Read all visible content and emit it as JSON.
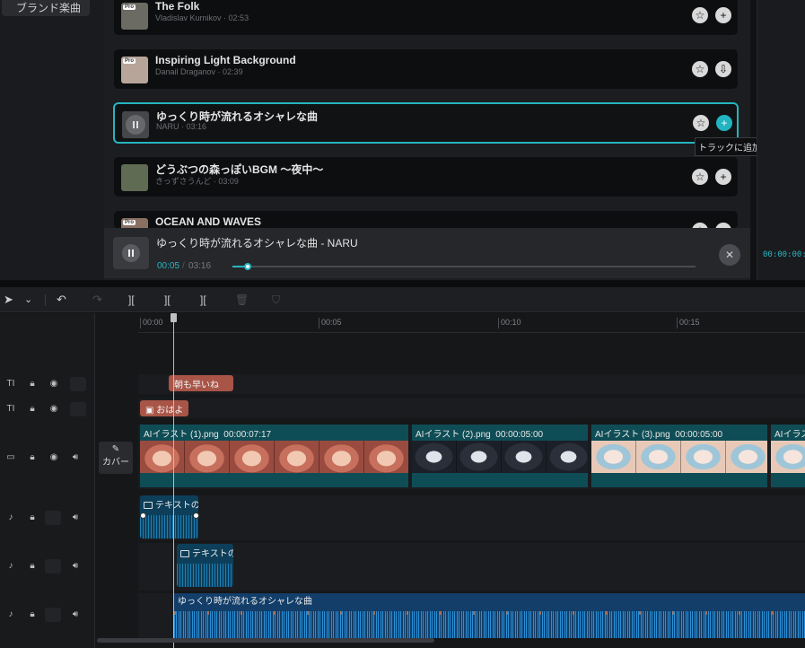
{
  "sidebar": {
    "active_label": "ブランド楽曲"
  },
  "tracks": [
    {
      "title": "The Folk",
      "artist": "Vladislav Kurnikov",
      "duration": "02:53",
      "pro": "Pro",
      "thumb_color": "#6b6a63",
      "action_icon": "plus-icon",
      "action_glyph": "+",
      "active": false
    },
    {
      "title": "Inspiring Light Background",
      "artist": "Danail Draganov",
      "duration": "02:39",
      "pro": "Pro",
      "thumb_color": "#b8a59a",
      "action_icon": "download-icon",
      "action_glyph": "⇩",
      "active": false
    },
    {
      "title": "ゆっくり時が流れるオシャレな曲",
      "artist": "NARU",
      "duration": "03:16",
      "pro": "",
      "thumb_color": "#45474b",
      "action_icon": "plus-icon",
      "action_glyph": "+",
      "active": true
    },
    {
      "title": "どうぶつの森っぽいBGM ～夜中～",
      "artist": "きっずさうんど",
      "duration": "03:09",
      "pro": "",
      "thumb_color": "#5f6b52",
      "action_icon": "plus-icon",
      "action_glyph": "+",
      "active": false
    },
    {
      "title": "OCEAN AND WAVES",
      "artist": "",
      "duration": "",
      "pro": "Pro",
      "thumb_color": "#8a6f63",
      "action_icon": "plus-icon",
      "action_glyph": "+",
      "active": false
    }
  ],
  "track_meta_sep": " · ",
  "tooltip": "トラックに追加",
  "player": {
    "title": "ゆっくり時が流れるオシャレな曲 - NARU",
    "current": "00:05",
    "separator": "/",
    "duration": "03:16",
    "progress": 0.033,
    "close_glyph": "✕"
  },
  "right_panel": {
    "timecode": "00:00:00:2"
  },
  "toolbar": {
    "select_glyph": "➤",
    "dropdown_glyph": "⌄",
    "undo_glyph": "↶",
    "redo_glyph": "↷",
    "split_glyph": "][",
    "trim_left_glyph": "][",
    "trim_right_glyph": "][",
    "delete_glyph": "🗑",
    "marker_glyph": "⛉"
  },
  "ruler": {
    "labels": [
      "00:00",
      "00:05",
      "00:10",
      "00:15"
    ]
  },
  "cover": {
    "label": "カバー",
    "glyph": "✎"
  },
  "text_clips": {
    "clip1": "朝も早いね",
    "clip2": "おはよ"
  },
  "video_clips": [
    {
      "name": "AIイラスト (1).png",
      "duration": "00:00:07:17",
      "style": "f1"
    },
    {
      "name": "AIイラスト (2).png",
      "duration": "00:00:05:00",
      "style": "f2"
    },
    {
      "name": "AIイラスト (3).png",
      "duration": "00:00:05:00",
      "style": "f3"
    },
    {
      "name": "AIイラス",
      "duration": "",
      "style": "f3"
    }
  ],
  "audio_clips": {
    "voice1": "テキストの",
    "voice2": "テキストの",
    "music": "ゆっくり時が流れるオシャレな曲"
  },
  "colors": {
    "accent": "#25b5c0",
    "text_clip": "#a85548",
    "video_clip": "#0f4d56",
    "audio_clip": "#123e69"
  }
}
